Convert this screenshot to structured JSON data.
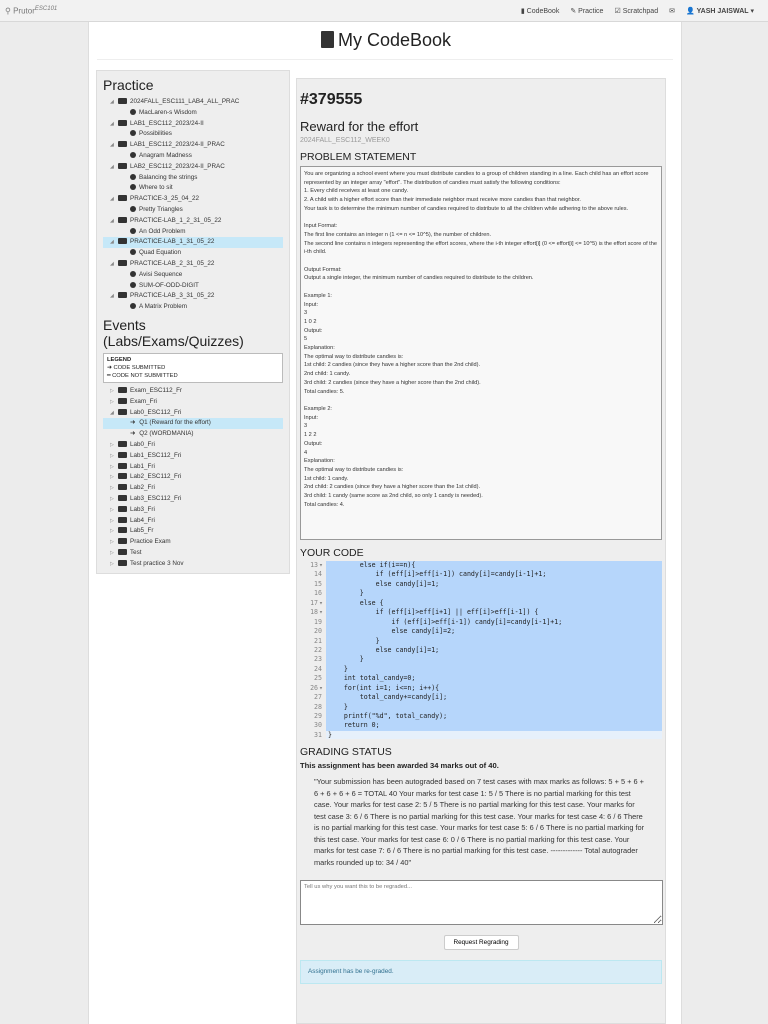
{
  "nav": {
    "brand": "Prutor",
    "brand_sup": "ESC101",
    "links": [
      "CodeBook",
      "Practice",
      "Scratchpad"
    ],
    "user": "YASH JAISWAL"
  },
  "page_title": "My CodeBook",
  "practice": {
    "heading": "Practice",
    "items": [
      {
        "label": "2024FALL_ESC111_LAB4_ALL_PRAC",
        "level": 1
      },
      {
        "label": "MacLaren-s Wisdom",
        "level": 2
      },
      {
        "label": "LAB1_ESC112_2023/24-II",
        "level": 1
      },
      {
        "label": "Possibilities",
        "level": 2
      },
      {
        "label": "LAB1_ESC112_2023/24-II_PRAC",
        "level": 1
      },
      {
        "label": "Anagram Madness",
        "level": 2
      },
      {
        "label": "LAB2_ESC112_2023/24-II_PRAC",
        "level": 1
      },
      {
        "label": "Balancing the strings",
        "level": 2
      },
      {
        "label": "Where to sit",
        "level": 2
      },
      {
        "label": "PRACTICE-3_25_04_22",
        "level": 1
      },
      {
        "label": "Pretty Triangles",
        "level": 2
      },
      {
        "label": "PRACTICE-LAB_1_2_31_05_22",
        "level": 1
      },
      {
        "label": "An Odd Problem",
        "level": 2
      },
      {
        "label": "PRACTICE-LAB_1_31_05_22",
        "level": 1,
        "selected": true
      },
      {
        "label": "Quad Equation",
        "level": 2
      },
      {
        "label": "PRACTICE-LAB_2_31_05_22",
        "level": 1
      },
      {
        "label": "Avisi Sequence",
        "level": 2
      },
      {
        "label": "SUM-OF-ODD-DIGIT",
        "level": 2
      },
      {
        "label": "PRACTICE-LAB_3_31_05_22",
        "level": 1
      },
      {
        "label": "A Matrix Problem",
        "level": 2
      }
    ]
  },
  "events": {
    "heading": "Events (Labs/Exams/Quizzes)",
    "legend": {
      "title": "LEGEND",
      "submitted": "CODE SUBMITTED",
      "not_submitted": "CODE NOT SUBMITTED"
    },
    "items": [
      {
        "label": "Exam_ESC112_Fr",
        "level": 1
      },
      {
        "label": "Exam_Fri",
        "level": 1
      },
      {
        "label": "Lab0_ESC112_Fri",
        "level": 1,
        "open": true
      },
      {
        "label": "Q1 (Reward for the effort)",
        "level": 2,
        "selected": true
      },
      {
        "label": "Q2 (WORDMANIA)",
        "level": 2
      },
      {
        "label": "Lab0_Fri",
        "level": 1
      },
      {
        "label": "Lab1_ESC112_Fri",
        "level": 1
      },
      {
        "label": "Lab1_Fri",
        "level": 1
      },
      {
        "label": "Lab2_ESC112_Fri",
        "level": 1
      },
      {
        "label": "Lab2_Fri",
        "level": 1
      },
      {
        "label": "Lab3_ESC112_Fri",
        "level": 1
      },
      {
        "label": "Lab3_Fri",
        "level": 1
      },
      {
        "label": "Lab4_Fri",
        "level": 1
      },
      {
        "label": "Lab5_Fr",
        "level": 1
      },
      {
        "label": "Practice Exam",
        "level": 1
      },
      {
        "label": "Test",
        "level": 1
      },
      {
        "label": "Test practice 3 Nov",
        "level": 1
      }
    ]
  },
  "problem": {
    "id": "#379555",
    "title": "Reward for the effort",
    "course": "2024FALL_ESC112_WEEK0",
    "statement_heading": "PROBLEM STATEMENT",
    "statement": "You are organizing a school event where you must distribute candies to a group of children standing in a line. Each child has an effort score represented by an integer array \"effort\". The distribution of candies must satisfy the following conditions:\n1. Every child receives at least one candy.\n2. A child with a higher effort score than their immediate neighbor must receive more candies than that neighbor.\nYour task is to determine the minimum number of candies required to distribute to all the children while adhering to the above rules.\n\nInput Format:\nThe first line contains an integer n (1 <= n <= 10^5), the number of children.\nThe second line contains n integers representing the effort scores, where the i-th integer effort[i] (0 <= effort[i] <= 10^5) is the effort score of the i-th child.\n\nOutput Format:\nOutput a single integer, the minimum number of candies required to distribute to the children.\n\nExample 1:\nInput:\n3\n1 0 2\nOutput:\n5\nExplanation:\nThe optimal way to distribute candies is:\n1st child: 2 candies (since they have a higher score than the 2nd child).\n2nd child: 1 candy.\n3rd child: 2 candies (since they have a higher score than the 2nd child).\nTotal candies: 5.\n\nExample 2:\nInput:\n3\n1 2 2\nOutput:\n4\nExplanation:\nThe optimal way to distribute candies is:\n1st child: 1 candy.\n2nd child: 2 candies (since they have a higher score than the 1st child).\n3rd child: 1 candy (same score as 2nd child, so only 1 candy is needed).\nTotal candies: 4."
  },
  "code": {
    "heading": "YOUR CODE",
    "lines": [
      {
        "n": "13",
        "fold": true,
        "t": "        else if(i==n){"
      },
      {
        "n": "14",
        "t": "            if (eff[i]>eff[i-1]) candy[i]=candy[i-1]+1;"
      },
      {
        "n": "15",
        "t": "            else candy[i]=1;"
      },
      {
        "n": "16",
        "t": "        }"
      },
      {
        "n": "17",
        "fold": true,
        "t": "        else {"
      },
      {
        "n": "18",
        "fold": true,
        "t": "            if (eff[i]>eff[i+1] || eff[i]>eff[i-1]) {"
      },
      {
        "n": "19",
        "t": "                if (eff[i]>eff[i-1]) candy[i]=candy[i-1]+1;"
      },
      {
        "n": "20",
        "t": "                else candy[i]=2;"
      },
      {
        "n": "21",
        "t": "            }"
      },
      {
        "n": "22",
        "t": "            else candy[i]=1;"
      },
      {
        "n": "23",
        "t": "        }"
      },
      {
        "n": "24",
        "t": "    }"
      },
      {
        "n": "25",
        "t": "    int total_candy=0;"
      },
      {
        "n": "26",
        "fold": true,
        "t": "    for(int i=1; i<=n; i++){"
      },
      {
        "n": "27",
        "t": "        total_candy+=candy[i];"
      },
      {
        "n": "28",
        "t": "    }"
      },
      {
        "n": "29",
        "t": "    printf(\"%d\", total_candy);"
      },
      {
        "n": "30",
        "t": "    return 0;"
      },
      {
        "n": "31",
        "t": "}"
      }
    ]
  },
  "grading": {
    "heading": "GRADING STATUS",
    "awarded_prefix": "This assignment has been awarded ",
    "marks": "34",
    "awarded_mid": " marks out of ",
    "total": "40",
    "awarded_suffix": ".",
    "details": "\"Your submission has been autograded based on 7 test cases with max marks as follows: 5 + 5 + 6 + 6 + 6 + 6 + 6 = TOTAL 40 Your marks for test case 1: 5 / 5 There is no partial marking for this test case. Your marks for test case 2: 5 / 5 There is no partial marking for this test case. Your marks for test case 3: 6 / 6 There is no partial marking for this test case. Your marks for test case 4: 6 / 6 There is no partial marking for this test case. Your marks for test case 5: 6 / 6 There is no partial marking for this test case. Your marks for test case 6: 0 / 6 There is no partial marking for this test case. Your marks for test case 7: 6 / 6 There is no partial marking for this test case. ------------- Total autograder marks rounded up to: 34 / 40\"",
    "regrade_placeholder": "Tell us why you want this to be regraded...",
    "regrade_button": "Request Regrading",
    "alert": "Assignment has be re-graded."
  }
}
